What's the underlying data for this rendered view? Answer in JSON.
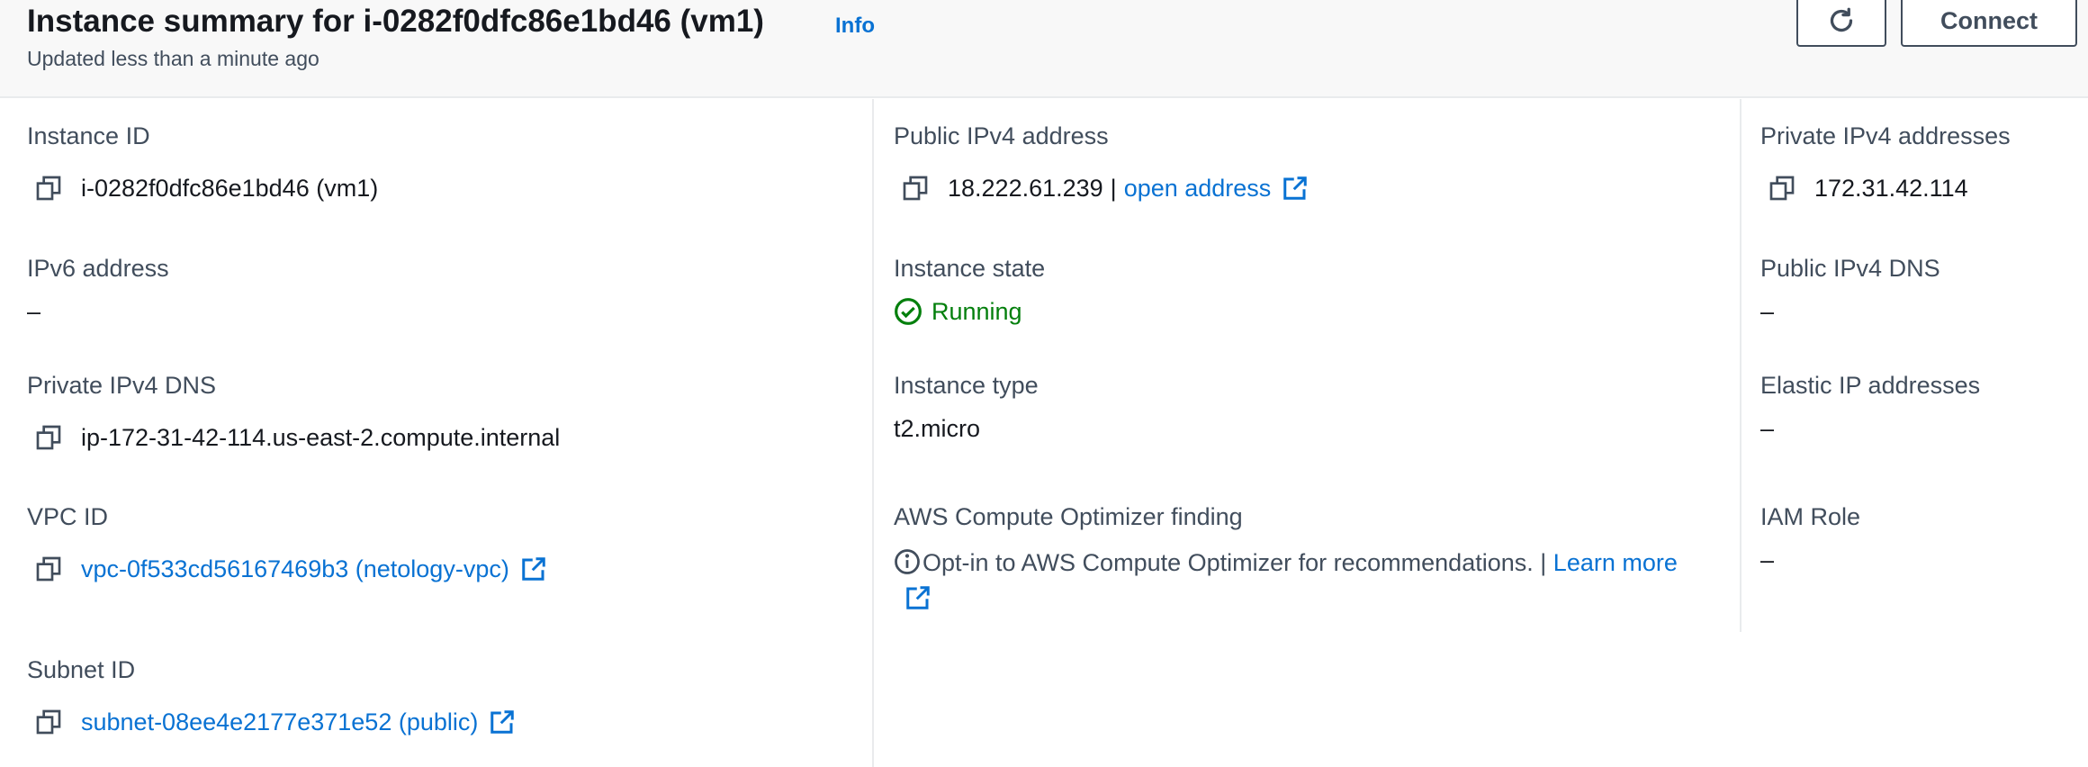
{
  "header": {
    "title": "Instance summary for i-0282f0dfc86e1bd46 (vm1)",
    "info_label": "Info",
    "subtitle": "Updated less than a minute ago",
    "connect_label": "Connect"
  },
  "fields": {
    "instance_id": {
      "label": "Instance ID",
      "value": "i-0282f0dfc86e1bd46 (vm1)"
    },
    "ipv6": {
      "label": "IPv6 address",
      "value": "–"
    },
    "private_dns": {
      "label": "Private IPv4 DNS",
      "value": "ip-172-31-42-114.us-east-2.compute.internal"
    },
    "vpc_id": {
      "label": "VPC ID",
      "value": "vpc-0f533cd56167469b3 (netology-vpc)"
    },
    "subnet_id": {
      "label": "Subnet ID",
      "value": "subnet-08ee4e2177e371e52 (public)"
    },
    "public_ipv4": {
      "label": "Public IPv4 address",
      "value": "18.222.61.239",
      "separator": "|",
      "link": "open address"
    },
    "instance_state": {
      "label": "Instance state",
      "value": "Running"
    },
    "instance_type": {
      "label": "Instance type",
      "value": "t2.micro"
    },
    "optimizer": {
      "label": "AWS Compute Optimizer finding",
      "text": "Opt-in to AWS Compute Optimizer for recommendations.",
      "separator": "|",
      "link": "Learn more"
    },
    "private_ipv4": {
      "label": "Private IPv4 addresses",
      "value": "172.31.42.114"
    },
    "public_dns": {
      "label": "Public IPv4 DNS",
      "value": "–"
    },
    "elastic_ip": {
      "label": "Elastic IP addresses",
      "value": "–"
    },
    "iam_role": {
      "label": "IAM Role",
      "value": "–"
    }
  },
  "colors": {
    "link": "#0972d3",
    "success": "#037f0c",
    "text": "#16191f",
    "label": "#414d5c",
    "header_bg": "#f8f8f8"
  },
  "icons": [
    "refresh-icon",
    "copy-icon",
    "external-link-icon",
    "status-check-icon",
    "info-icon"
  ]
}
